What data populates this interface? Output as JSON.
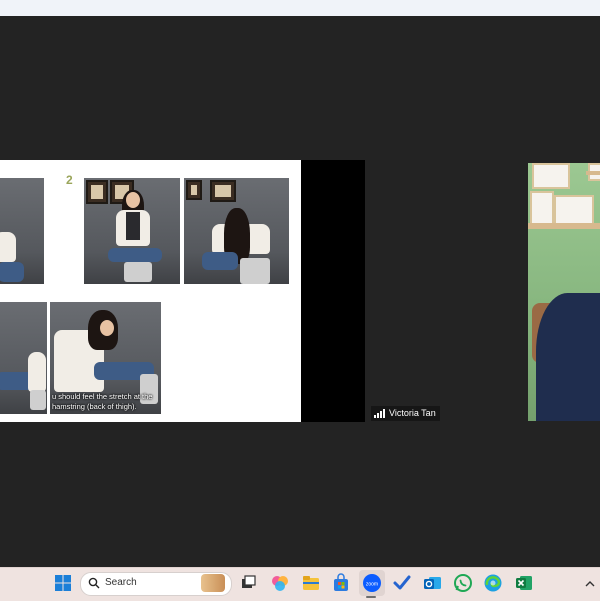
{
  "slide": {
    "step_number": "2",
    "subtitle": "u should feel the stretch at the hamstring (back of thigh)."
  },
  "participant": {
    "name": "Victoria Tan"
  },
  "taskbar": {
    "search_label": "Search",
    "apps": [
      "windows-start",
      "task-view",
      "copilot",
      "file-explorer",
      "microsoft-store",
      "zoom",
      "todo",
      "outlook",
      "whatsapp",
      "edge",
      "excel"
    ]
  },
  "colors": {
    "accent_step": "#9aa55a",
    "taskbar_bg": "#efe3e0",
    "background": "#232323"
  }
}
